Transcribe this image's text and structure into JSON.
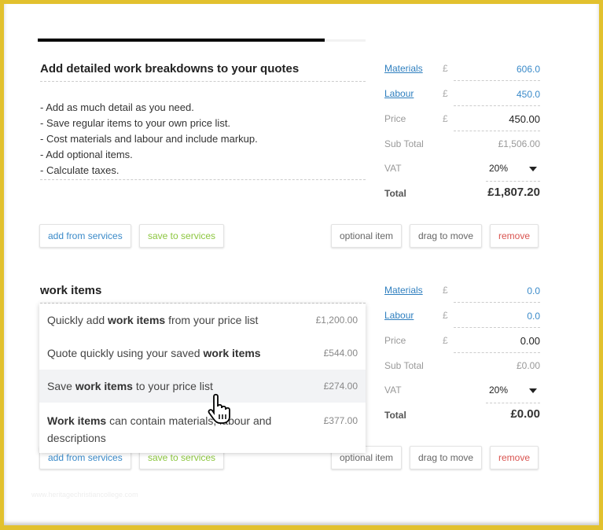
{
  "progress": {
    "percent": 87
  },
  "card1": {
    "title": "Add detailed work breakdowns to your quotes",
    "lines": [
      "- Add as much detail as you need.",
      "- Save regular items to your own price list.",
      "- Cost materials and labour and include markup.",
      "- Add optional items.",
      "- Calculate taxes."
    ],
    "materials_label": "Materials",
    "materials_value": "606.0",
    "labour_label": "Labour",
    "labour_value": "450.0",
    "price_label": "Price",
    "price_value": "450.00",
    "currency": "£",
    "subtotal_label": "Sub Total",
    "subtotal_value": "£1,506.00",
    "vat_label": "VAT",
    "vat_value": "20%",
    "total_label": "Total",
    "total_value": "£1,807.20"
  },
  "card2": {
    "title": "work items",
    "materials_label": "Materials",
    "materials_value": "0.0",
    "labour_label": "Labour",
    "labour_value": "0.0",
    "price_label": "Price",
    "price_value": "0.00",
    "currency": "£",
    "subtotal_label": "Sub Total",
    "subtotal_value": "£0.00",
    "vat_label": "VAT",
    "vat_value": "20%",
    "total_label": "Total",
    "total_value": "£0.00",
    "suggestions": [
      {
        "pre": "Quickly add ",
        "bold": "work items",
        "post": " from your price list",
        "price": "£1,200.00"
      },
      {
        "pre": "Quote quickly using your saved ",
        "bold": "work items",
        "post": "",
        "price": "£544.00"
      },
      {
        "pre": "Save ",
        "bold": "work items",
        "post": " to your price list",
        "price": "£274.00"
      },
      {
        "pre": "",
        "bold": "Work items",
        "post": " can contain materials, labour and descriptions",
        "price": "£377.00"
      }
    ]
  },
  "buttons": {
    "add_from_services": "add from services",
    "save_to_services": "save to services",
    "optional_item": "optional item",
    "drag_to_move": "drag to move",
    "remove": "remove"
  },
  "colors": {
    "link": "#2f7fbf",
    "save": "#8cc63f",
    "remove": "#d9534f",
    "border": "#e2c12e"
  },
  "watermark": "www.heritagechristiancollege.com"
}
